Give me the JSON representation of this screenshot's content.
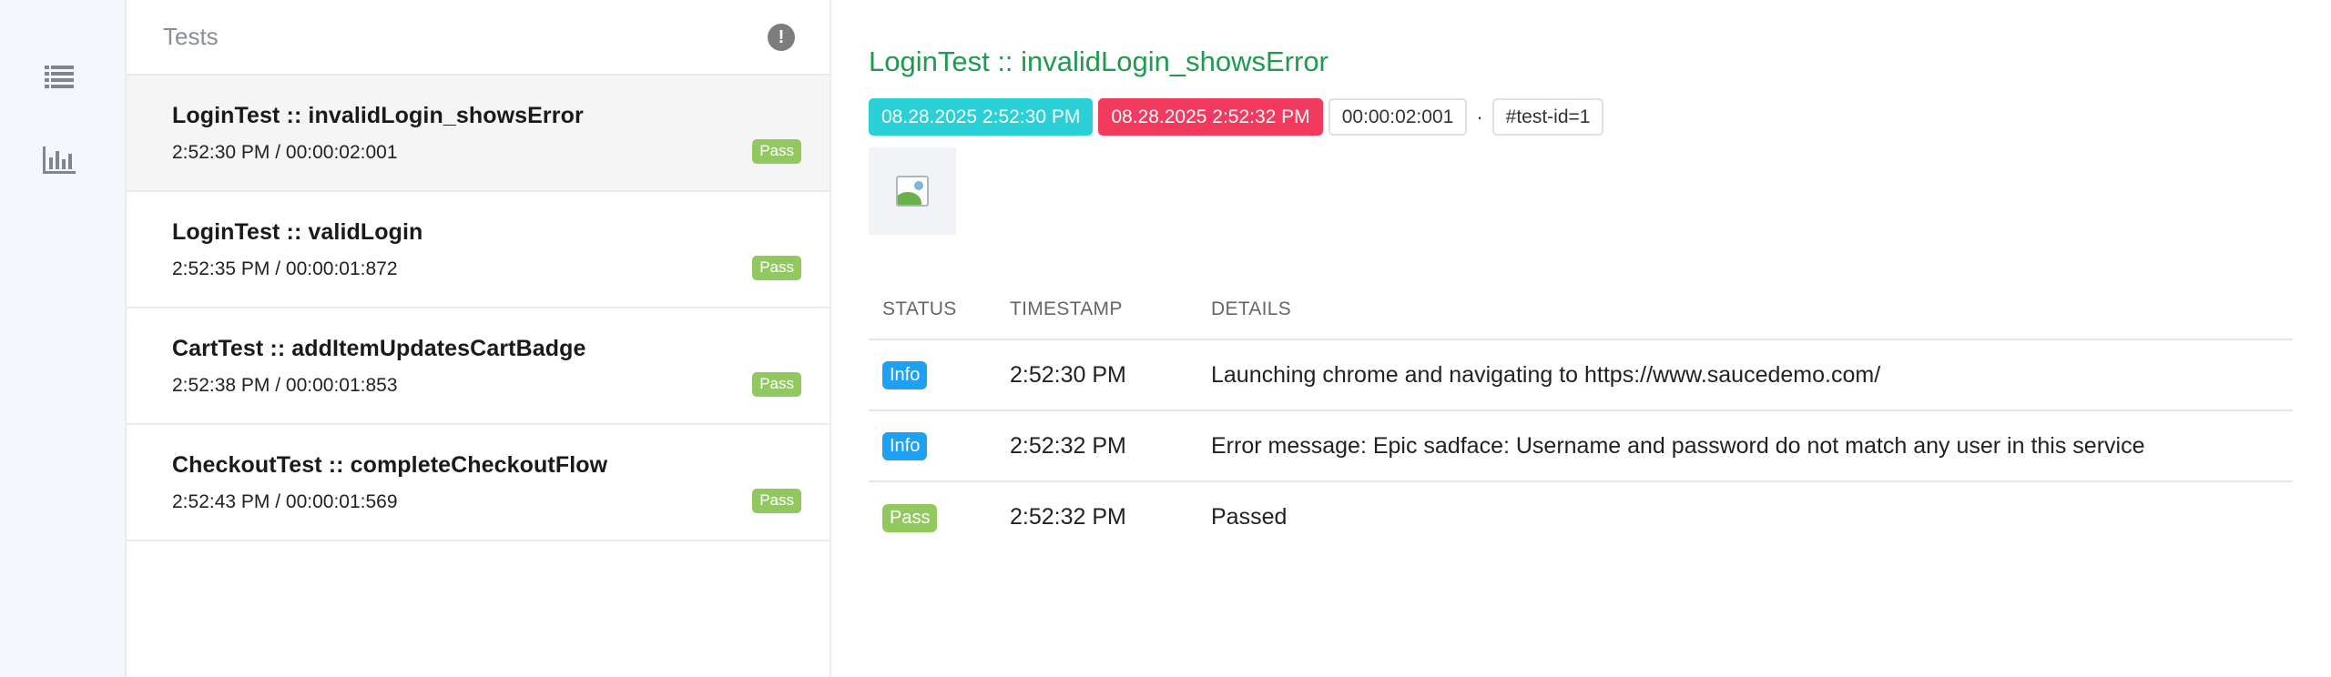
{
  "rail": {
    "items": [
      {
        "name": "list-icon"
      },
      {
        "name": "bar-chart-icon"
      }
    ]
  },
  "list": {
    "header": "Tests",
    "alert_icon": "!",
    "tests": [
      {
        "name": "LoginTest :: invalidLogin_showsError",
        "time": "2:52:30 PM / 00:00:02:001",
        "status": "Pass"
      },
      {
        "name": "LoginTest :: validLogin",
        "time": "2:52:35 PM / 00:00:01:872",
        "status": "Pass"
      },
      {
        "name": "CartTest :: addItemUpdatesCartBadge",
        "time": "2:52:38 PM / 00:00:01:853",
        "status": "Pass"
      },
      {
        "name": "CheckoutTest :: completeCheckoutFlow",
        "time": "2:52:43 PM / 00:00:01:569",
        "status": "Pass"
      }
    ]
  },
  "detail": {
    "title": "LoginTest :: invalidLogin_showsError",
    "start": "08.28.2025 2:52:30 PM",
    "end": "08.28.2025 2:52:32 PM",
    "duration": "00:00:02:001",
    "separator": "·",
    "test_id": "#test-id=1",
    "table": {
      "headers": {
        "status": "STATUS",
        "timestamp": "TIMESTAMP",
        "details": "DETAILS"
      },
      "rows": [
        {
          "status": "Info",
          "timestamp": "2:52:30 PM",
          "details": "Launching chrome and navigating to https://www.saucedemo.com/"
        },
        {
          "status": "Info",
          "timestamp": "2:52:32 PM",
          "details": "Error message: Epic sadface: Username and password do not match any user in this service"
        },
        {
          "status": "Pass",
          "timestamp": "2:52:32 PM",
          "details": "Passed"
        }
      ]
    }
  },
  "colors": {
    "title_green": "#1f9a4e",
    "start_teal": "#2bcfd6",
    "end_red": "#f23a5e",
    "pass_green": "#92c95f",
    "info_blue": "#1ea1f2"
  }
}
